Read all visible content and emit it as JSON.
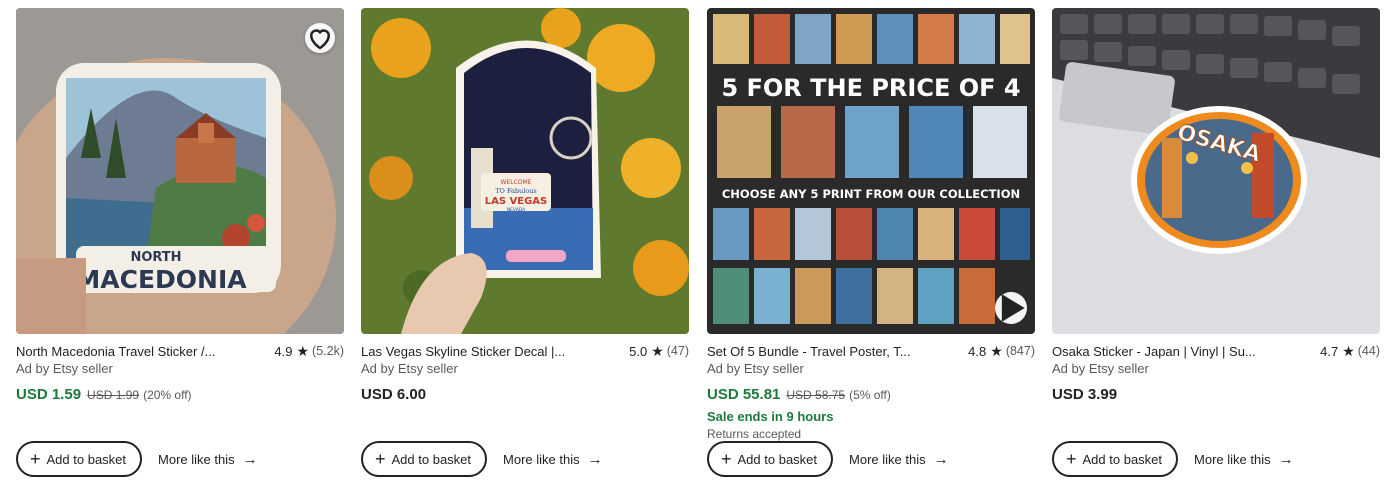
{
  "listings": [
    {
      "title": "North Macedonia Travel Sticker /...",
      "rating": "4.9",
      "reviews": "(5.2k)",
      "ad_label": "Ad by Etsy seller",
      "price": "USD 1.59",
      "original_price": "USD 1.99",
      "discount": "(20% off)",
      "add_label": "Add to basket",
      "more_label": "More like this",
      "image_text": [
        "NORTH",
        "MACEDONIA"
      ]
    },
    {
      "title": "Las Vegas Skyline Sticker Decal |...",
      "rating": "5.0",
      "reviews": "(47)",
      "ad_label": "Ad by Etsy seller",
      "price": "USD 6.00",
      "add_label": "Add to basket",
      "more_label": "More like this",
      "image_text": [
        "WELCOME",
        "TO Fabulous",
        "LAS VEGAS",
        "NEVADA"
      ]
    },
    {
      "title": "Set Of 5 Bundle - Travel Poster, T...",
      "rating": "4.8",
      "reviews": "(847)",
      "ad_label": "Ad by Etsy seller",
      "price": "USD 55.81",
      "original_price": "USD 58.75",
      "discount": "(5% off)",
      "sale_note": "Sale ends in 9 hours",
      "returns": "Returns accepted",
      "add_label": "Add to basket",
      "more_label": "More like this",
      "image_text": [
        "5 FOR THE PRICE OF 4",
        "CHOOSE ANY 5 PRINT FROM OUR COLLECTION"
      ]
    },
    {
      "title": "Osaka Sticker - Japan | Vinyl | Su...",
      "rating": "4.7",
      "reviews": "(44)",
      "ad_label": "Ad by Etsy seller",
      "price": "USD 3.99",
      "add_label": "Add to basket",
      "more_label": "More like this",
      "image_text": [
        "OSAKA"
      ]
    }
  ],
  "icons": {
    "favorite": "heart-icon",
    "rating": "star-icon",
    "add": "plus-icon",
    "more": "arrow-right-icon",
    "video": "play-icon"
  },
  "colors": {
    "sale_price": "#1c7a3c",
    "text": "#222222",
    "muted": "#595959"
  }
}
